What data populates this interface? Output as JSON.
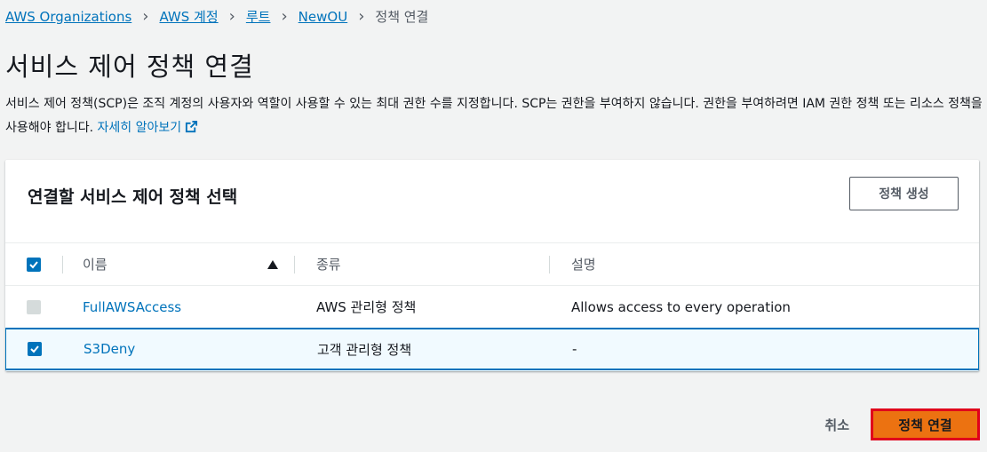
{
  "breadcrumb": {
    "items": [
      "AWS Organizations",
      "AWS 계정",
      "루트",
      "NewOU"
    ],
    "current": "정책 연결"
  },
  "page": {
    "title": "서비스 제어 정책 연결",
    "description": "서비스 제어 정책(SCP)은 조직 계정의 사용자와 역할이 사용할 수 있는 최대 권한 수를 지정합니다. SCP는 권한을 부여하지 않습니다. 권한을 부여하려면 IAM 권한 정책 또는 리소스 정책을 사용해야 합니다.",
    "learn_more": "자세히 알아보기"
  },
  "panel": {
    "title": "연결할 서비스 제어 정책 선택",
    "create_button": "정책 생성",
    "columns": {
      "name": "이름",
      "type": "종류",
      "description": "설명"
    },
    "rows": [
      {
        "name": "FullAWSAccess",
        "type": "AWS 관리형 정책",
        "description": "Allows access to every operation",
        "checked": false,
        "disabled": true
      },
      {
        "name": "S3Deny",
        "type": "고객 관리형 정책",
        "description": "-",
        "checked": true,
        "disabled": false
      }
    ]
  },
  "footer": {
    "cancel": "취소",
    "attach": "정책 연결"
  },
  "colors": {
    "link": "#0073bb",
    "primary": "#ec7211",
    "highlight_border": "#e0001b",
    "background": "#f2f3f3"
  },
  "icons": {
    "breadcrumb_separator": "chevron-right-icon",
    "external": "external-link-icon",
    "sort": "sort-ascending-icon",
    "check": "check-icon"
  }
}
